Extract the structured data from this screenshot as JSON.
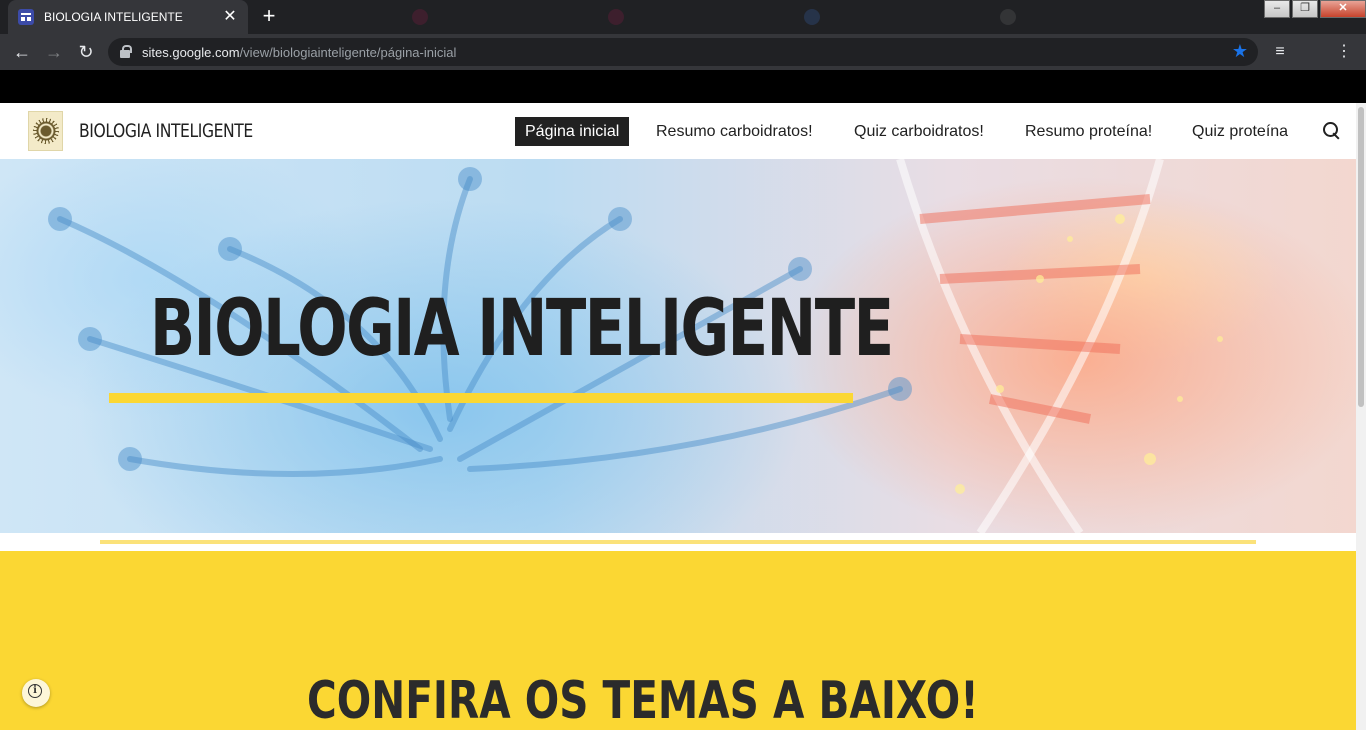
{
  "browser": {
    "active_tab_title": "BIOLOGIA INTELIGENTE",
    "close_glyph": "✕",
    "new_tab_glyph": "+",
    "url_host": "sites.google.com",
    "url_path": "/view/biologiainteligente/página-inicial",
    "back_icon": "←",
    "forward_icon": "→",
    "reload_icon": "↻",
    "star_icon": "★",
    "media_icon": "≡",
    "menu_icon": "⋮",
    "win_minimize": "–",
    "win_maximize": "❐",
    "win_close": "✕"
  },
  "site": {
    "title": "BIOLOGIA INTELIGENTE",
    "nav": [
      {
        "label": "Página inicial",
        "active": true
      },
      {
        "label": "Resumo carboidratos!"
      },
      {
        "label": "Quiz carboidratos!"
      },
      {
        "label": "Resumo proteína!"
      },
      {
        "label": "Quiz proteína"
      }
    ]
  },
  "hero": {
    "title": "BIOLOGIA INTELIGENTE"
  },
  "section": {
    "heading": "CONFIRA OS TEMAS A BAIXO!"
  },
  "colors": {
    "accent_yellow": "#fbd733",
    "nav_active_bg": "#212121",
    "browser_dark": "#202124"
  }
}
